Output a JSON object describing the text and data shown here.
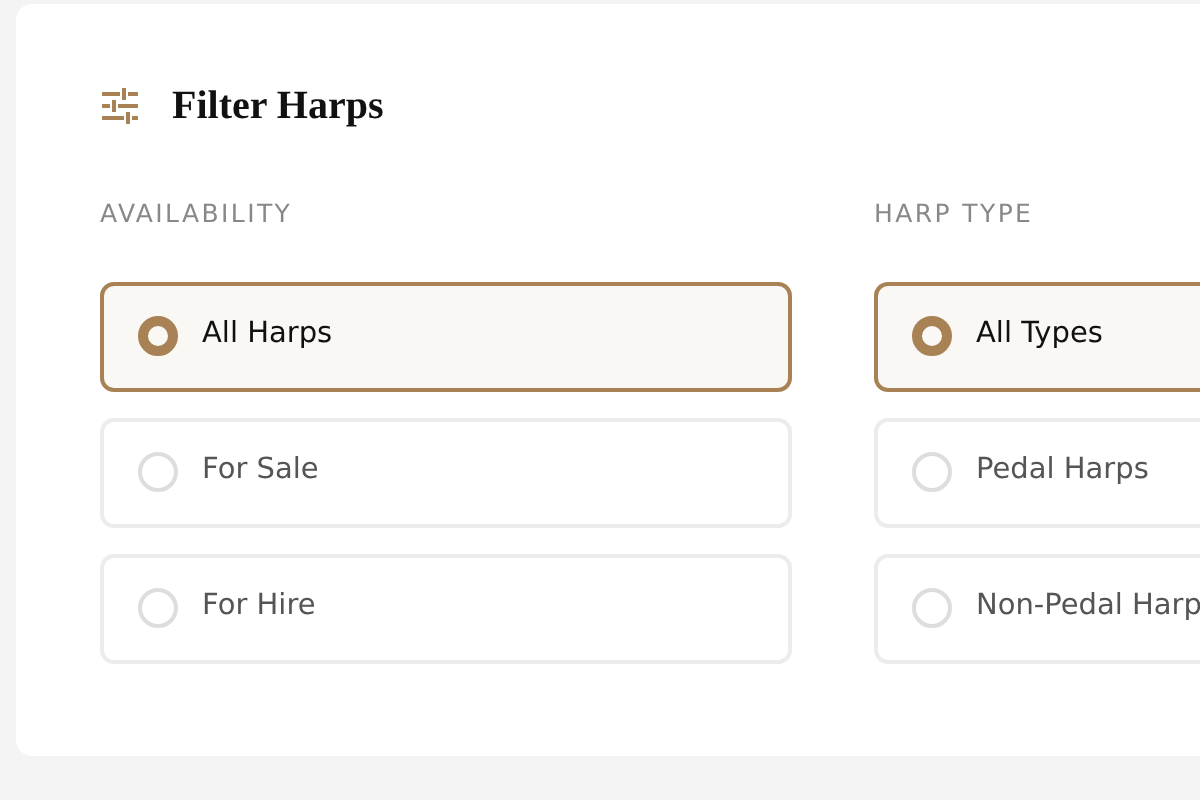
{
  "title": "Filter Harps",
  "groups": [
    {
      "label": "AVAILABILITY",
      "options": [
        {
          "label": "All Harps",
          "selected": true
        },
        {
          "label": "For Sale",
          "selected": false
        },
        {
          "label": "For Hire",
          "selected": false
        }
      ]
    },
    {
      "label": "HARP TYPE",
      "options": [
        {
          "label": "All Types",
          "selected": true
        },
        {
          "label": "Pedal Harps",
          "selected": false
        },
        {
          "label": "Non-Pedal Harp",
          "selected": false
        }
      ]
    }
  ]
}
